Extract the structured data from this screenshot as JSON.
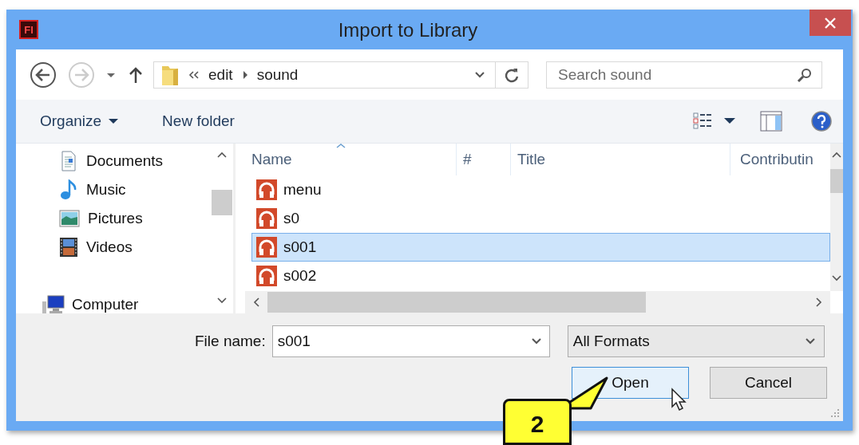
{
  "window": {
    "title": "Import to Library",
    "app_icon_text": "Fl"
  },
  "navigation": {
    "path": [
      {
        "label": "edit"
      },
      {
        "label": "sound"
      }
    ],
    "search": {
      "placeholder": "Search sound"
    }
  },
  "toolbar": {
    "organize": "Organize",
    "new_folder": "New folder"
  },
  "sidebar": {
    "library_items": [
      {
        "label": "Documents",
        "kind": "documents"
      },
      {
        "label": "Music",
        "kind": "music"
      },
      {
        "label": "Pictures",
        "kind": "pictures"
      },
      {
        "label": "Videos",
        "kind": "videos"
      }
    ],
    "computer": {
      "label": "Computer"
    }
  },
  "file_list": {
    "columns": [
      "Name",
      "#",
      "Title",
      "Contributin"
    ],
    "rows": [
      {
        "name": "menu",
        "selected": false
      },
      {
        "name": "s0",
        "selected": false
      },
      {
        "name": "s001",
        "selected": true
      },
      {
        "name": "s002",
        "selected": false
      }
    ]
  },
  "file_name": {
    "label": "File name:",
    "value": "s001"
  },
  "file_type": {
    "value": "All Formats"
  },
  "buttons": [
    {
      "label": "Open",
      "focused": true
    },
    {
      "label": "Cancel",
      "focused": false
    }
  ],
  "callout": {
    "text": "2"
  }
}
